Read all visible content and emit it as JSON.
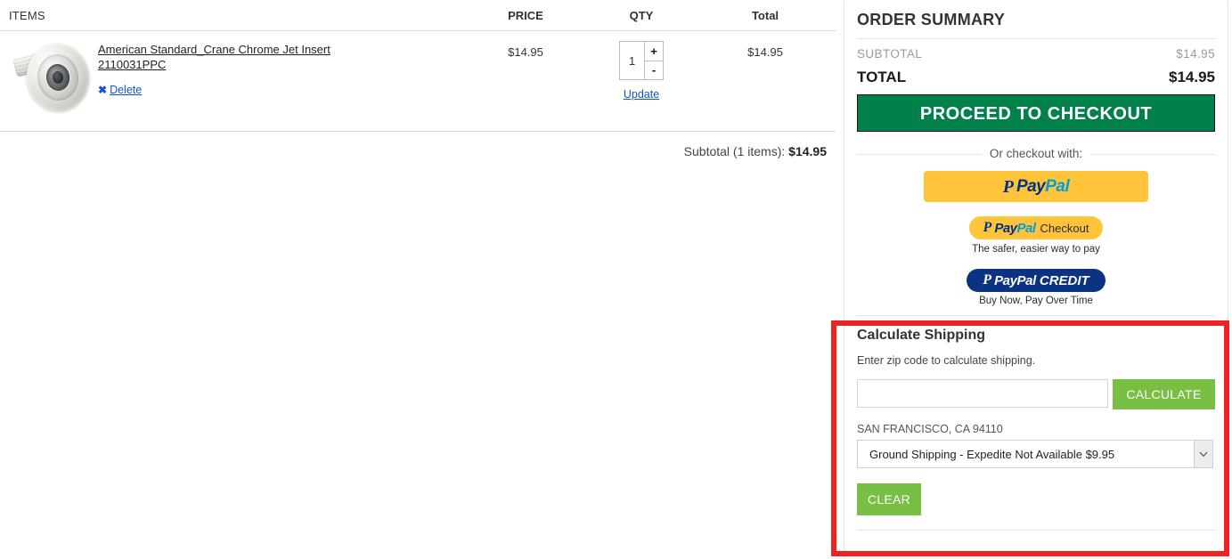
{
  "cart": {
    "columns": {
      "items": "ITEMS",
      "price": "PRICE",
      "qty": "QTY",
      "total": "Total"
    },
    "rows": [
      {
        "title": "American Standard_Crane Chrome Jet Insert 2110031PPC",
        "delete_label": "Delete",
        "delete_icon": "close-x-icon",
        "price": "$14.95",
        "qty_value": "1",
        "qty_increment": "+",
        "qty_decrement": "-",
        "update_label": "Update",
        "total": "$14.95",
        "thumbnail_icon": "product-thumbnail-chrome-jet-insert"
      }
    ],
    "subtotal_label": "Subtotal (1 items):",
    "subtotal_value": "$14.95"
  },
  "summary": {
    "title": "ORDER SUMMARY",
    "subtotal_label": "SUBTOTAL",
    "subtotal_value": "$14.95",
    "total_label": "TOTAL",
    "total_value": "$14.95",
    "checkout_button": "PROCEED TO CHECKOUT",
    "or_checkout_with": "Or checkout with:",
    "paypal": {
      "p_glyph": "P",
      "pay": "Pay",
      "pal": "Pal",
      "checkout_suffix": "Checkout",
      "checkout_tagline": "The safer, easier way to pay",
      "credit_word": "PayPal",
      "credit_suffix": "CREDIT",
      "credit_tagline": "Buy Now, Pay Over Time"
    }
  },
  "shipping": {
    "title": "Calculate Shipping",
    "description": "Enter zip code to calculate shipping.",
    "zip_value": "",
    "zip_placeholder": "",
    "calculate_button": "CALCULATE",
    "city_state_zip": "SAN FRANCISCO, CA 94110",
    "selected_method": "Ground Shipping - Expedite Not Available $9.95",
    "method_options": [
      "Ground Shipping - Expedite Not Available $9.95"
    ],
    "clear_button": "CLEAR"
  },
  "colors": {
    "checkout_green": "#00804a",
    "action_green": "#78bf43",
    "highlight_red": "#ee2222",
    "link_blue": "#1155cc",
    "paypal_yellow": "#ffc43a",
    "paypal_blue": "#003087",
    "paypal_lightblue": "#009cde",
    "paypal_credit_navy": "#0c3282"
  }
}
